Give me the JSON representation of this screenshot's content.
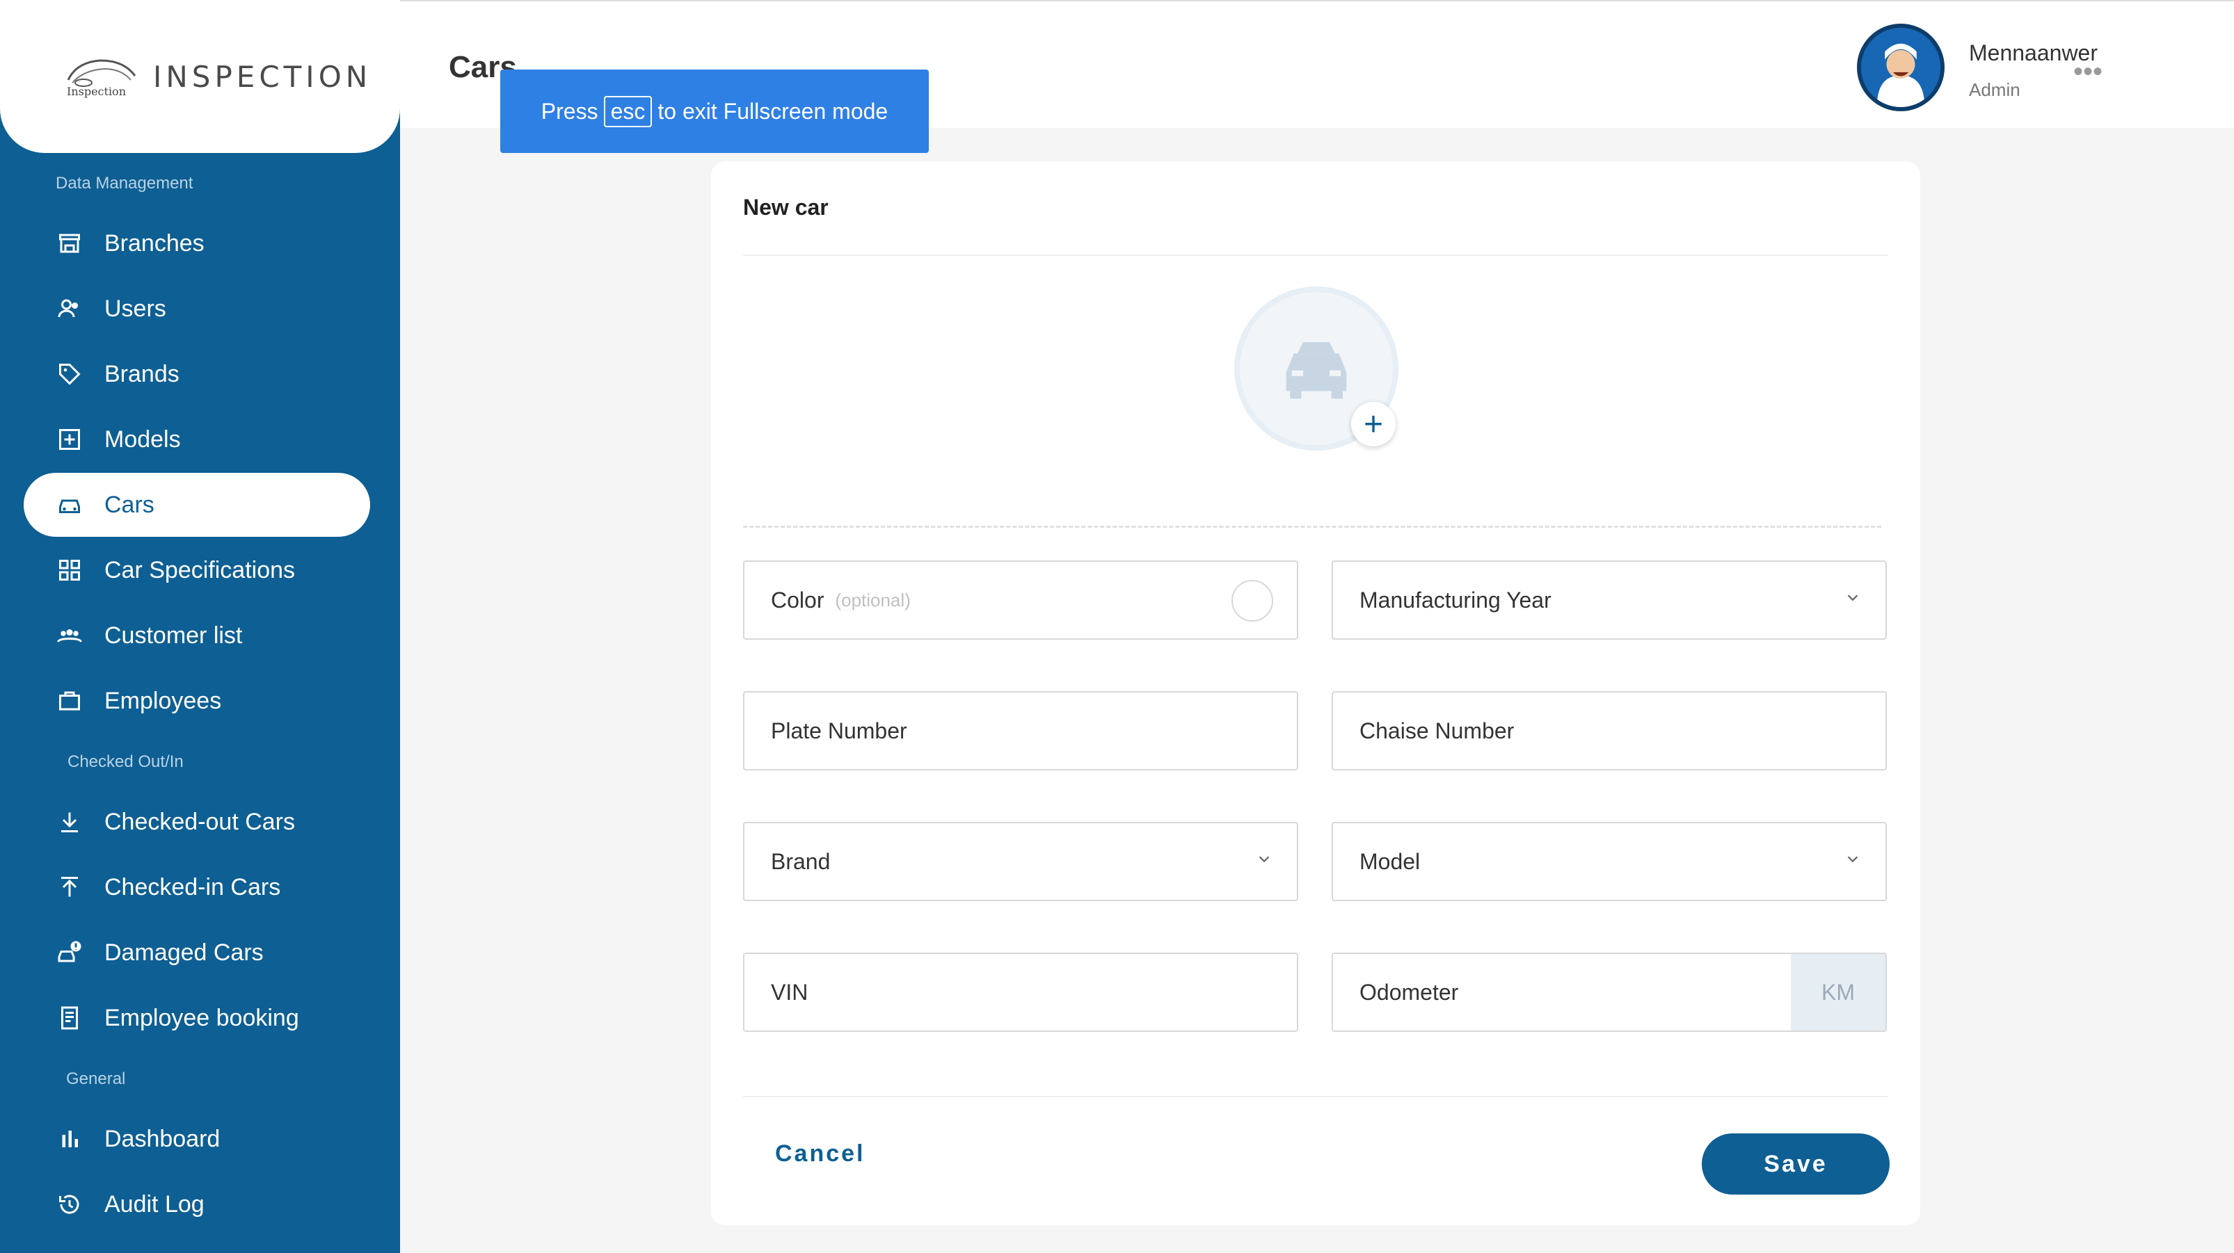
{
  "app": {
    "logo_text": "INSPECTION",
    "logo_mark_text": "Inspection"
  },
  "sidebar": {
    "sections": {
      "data_management": "Data Management",
      "checked": "Checked Out/In",
      "general": "General"
    },
    "items": [
      {
        "label": "Branches",
        "icon": "store-icon"
      },
      {
        "label": "Users",
        "icon": "users-icon"
      },
      {
        "label": "Brands",
        "icon": "tag-icon"
      },
      {
        "label": "Models",
        "icon": "model-icon"
      },
      {
        "label": "Cars",
        "icon": "car-icon",
        "active": true
      },
      {
        "label": "Car Specifications",
        "icon": "grid-icon"
      },
      {
        "label": "Customer list",
        "icon": "group-icon"
      },
      {
        "label": "Employees",
        "icon": "briefcase-icon"
      },
      {
        "label": "Checked-out Cars",
        "icon": "download-icon"
      },
      {
        "label": "Checked-in Cars",
        "icon": "upload-icon"
      },
      {
        "label": "Damaged Cars",
        "icon": "damaged-car-icon"
      },
      {
        "label": "Employee booking",
        "icon": "booking-icon"
      },
      {
        "label": "Dashboard",
        "icon": "bar-chart-icon"
      },
      {
        "label": "Audit Log",
        "icon": "history-icon"
      }
    ]
  },
  "header": {
    "title": "Cars",
    "toast": {
      "before": "Press",
      "key": "esc",
      "after": "to exit Fullscreen mode"
    },
    "user": {
      "name": "Mennaanwer",
      "role": "Admin"
    },
    "more": "•••"
  },
  "form": {
    "title": "New car",
    "fields": {
      "color": {
        "label": "Color",
        "optional": "(optional)"
      },
      "manufacturing_year": {
        "placeholder": "Manufacturing Year"
      },
      "plate_number": {
        "placeholder": "Plate Number"
      },
      "chaise_number": {
        "placeholder": "Chaise Number"
      },
      "brand": {
        "placeholder": "Brand"
      },
      "model": {
        "placeholder": "Model"
      },
      "vin": {
        "placeholder": "VIN"
      },
      "odometer": {
        "placeholder": "Odometer",
        "unit": "KM"
      }
    },
    "add_symbol": "+",
    "cancel_label": "Cancel",
    "save_label": "Save"
  },
  "colors": {
    "primary": "#0e5f93",
    "toast": "#2f80e4"
  }
}
